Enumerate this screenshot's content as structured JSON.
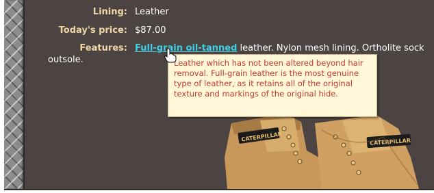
{
  "product": {
    "lining_label": "Lining:",
    "lining_value": "Leather",
    "price_label": "Today's price:",
    "price_value": "$87.00",
    "features_label": "Features:",
    "features_link": "Full-grain oil-tanned",
    "features_text": "leather. Nylon mesh lining. Ortholite sock",
    "features_text_cont": "outsole."
  },
  "tooltip": {
    "text": "Leather which has not been altered beyond hair removal. Full-grain leather is the most genuine type of leather, as it retains all of the original texture and markings of the original hide."
  },
  "boots": {
    "brand_left": "CATERPILLAR",
    "brand_right": "CATERPILLAR"
  },
  "icons": {
    "cursor": "hand-pointer-icon",
    "border": "diamond-plate-border"
  },
  "colors": {
    "background": "#4b4442",
    "label": "#f0d6a6",
    "link": "#3fd0e8",
    "tooltip_bg": "#fff7d8",
    "tooltip_text": "#c0392b"
  }
}
